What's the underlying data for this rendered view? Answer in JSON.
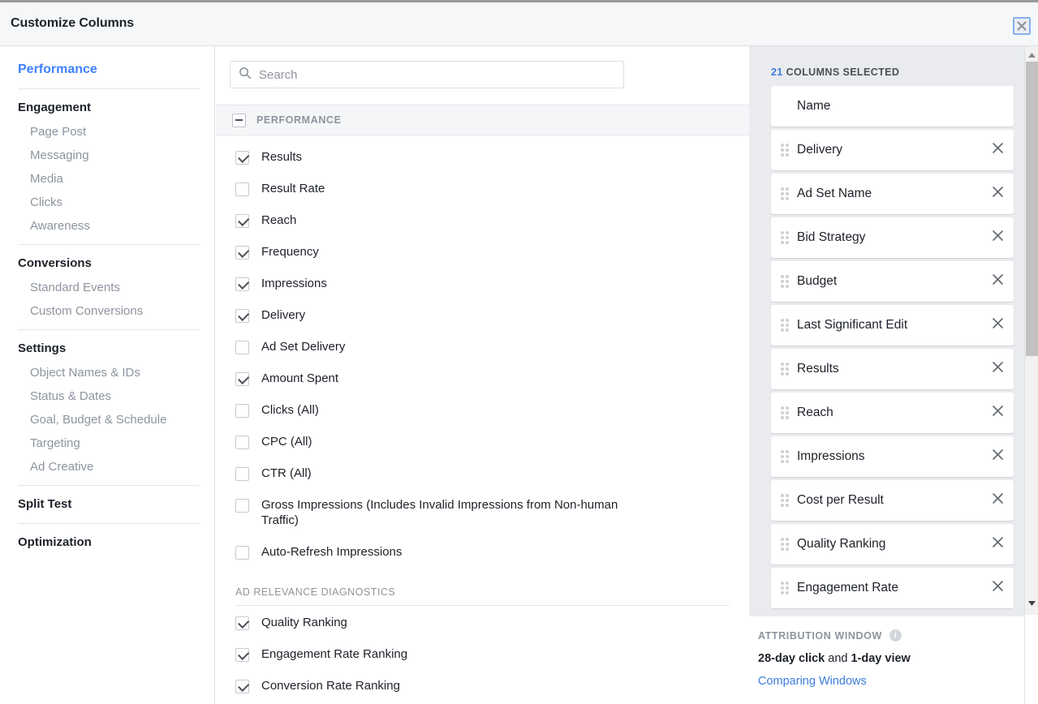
{
  "header": {
    "title": "Customize Columns",
    "close_label": "×"
  },
  "sidebar": {
    "active": "Performance",
    "groups": [
      {
        "title": "Engagement",
        "items": [
          "Page Post",
          "Messaging",
          "Media",
          "Clicks",
          "Awareness"
        ]
      },
      {
        "title": "Conversions",
        "items": [
          "Standard Events",
          "Custom Conversions"
        ]
      },
      {
        "title": "Settings",
        "items": [
          "Object Names & IDs",
          "Status & Dates",
          "Goal, Budget & Schedule",
          "Targeting",
          "Ad Creative"
        ]
      },
      {
        "title": "Split Test",
        "items": []
      },
      {
        "title": "Optimization",
        "items": []
      }
    ]
  },
  "search": {
    "placeholder": "Search",
    "value": "",
    "icon": "search-icon"
  },
  "middle": {
    "group_header": "PERFORMANCE",
    "collapse_icon": "minus-icon",
    "options": [
      {
        "label": "Results",
        "checked": true
      },
      {
        "label": "Result Rate",
        "checked": false
      },
      {
        "label": "Reach",
        "checked": true
      },
      {
        "label": "Frequency",
        "checked": true
      },
      {
        "label": "Impressions",
        "checked": true
      },
      {
        "label": "Delivery",
        "checked": true
      },
      {
        "label": "Ad Set Delivery",
        "checked": false
      },
      {
        "label": "Amount Spent",
        "checked": true
      },
      {
        "label": "Clicks (All)",
        "checked": false
      },
      {
        "label": "CPC (All)",
        "checked": false
      },
      {
        "label": "CTR (All)",
        "checked": false
      },
      {
        "label": "Gross Impressions (Includes Invalid Impressions from Non-human Traffic)",
        "checked": false,
        "tall": true
      },
      {
        "label": "Auto-Refresh Impressions",
        "checked": false
      }
    ],
    "subsection_title": "AD RELEVANCE DIAGNOSTICS",
    "subsection_options": [
      {
        "label": "Quality Ranking",
        "checked": true
      },
      {
        "label": "Engagement Rate Ranking",
        "checked": true
      },
      {
        "label": "Conversion Rate Ranking",
        "checked": true
      }
    ]
  },
  "right": {
    "count": "21",
    "count_suffix": "COLUMNS SELECTED",
    "columns": [
      {
        "label": "Name",
        "removable": false,
        "draggable": false
      },
      {
        "label": "Delivery",
        "removable": true,
        "draggable": true
      },
      {
        "label": "Ad Set Name",
        "removable": true,
        "draggable": true
      },
      {
        "label": "Bid Strategy",
        "removable": true,
        "draggable": true
      },
      {
        "label": "Budget",
        "removable": true,
        "draggable": true
      },
      {
        "label": "Last Significant Edit",
        "removable": true,
        "draggable": true
      },
      {
        "label": "Results",
        "removable": true,
        "draggable": true
      },
      {
        "label": "Reach",
        "removable": true,
        "draggable": true
      },
      {
        "label": "Impressions",
        "removable": true,
        "draggable": true
      },
      {
        "label": "Cost per Result",
        "removable": true,
        "draggable": true
      },
      {
        "label": "Quality Ranking",
        "removable": true,
        "draggable": true
      },
      {
        "label": "Engagement Rate",
        "removable": true,
        "draggable": true
      }
    ],
    "attribution": {
      "title": "ATTRIBUTION WINDOW",
      "info_icon": "info-icon",
      "value_part1": "28-day click",
      "value_mid": " and ",
      "value_part2": "1-day view",
      "link": "Comparing Windows"
    }
  },
  "colors": {
    "accent_blue": "#3b7ddd",
    "nav_active": "#4080ff",
    "panel_bg": "#e9ebee",
    "band_bg": "#f5f6f7",
    "text": "#1d2129",
    "muted": "#8d949e"
  }
}
